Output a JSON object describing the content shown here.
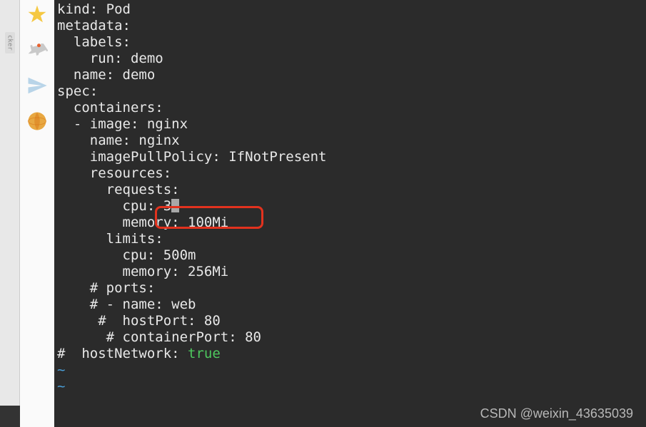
{
  "sidebar": {
    "tag": "cker"
  },
  "code": {
    "lines": [
      "kind: Pod",
      "metadata:",
      "  labels:",
      "    run: demo",
      "  name: demo",
      "spec:",
      "  containers:",
      "  - image: nginx",
      "    name: nginx",
      "    imagePullPolicy: IfNotPresent",
      "    resources:",
      "      requests:",
      "        cpu: 3",
      "        memory: 100Mi",
      "      limits:",
      "        cpu: 500m",
      "        memory: 256Mi",
      "",
      "    # ports:",
      "    # - name: web",
      "     #  hostPort: 80",
      "      # containerPort: 80"
    ],
    "hostNetworkLine": {
      "prefix": "#  hostNetwork: ",
      "value": "true"
    },
    "tilde": "~"
  },
  "watermark": "CSDN @weixin_43635039"
}
